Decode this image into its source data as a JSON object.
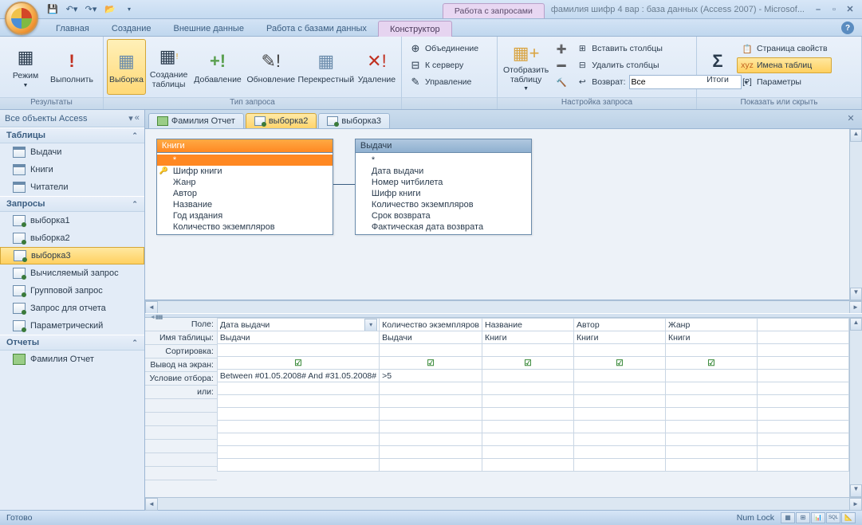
{
  "title": {
    "context": "Работа с запросами",
    "app": "фамилия шифр 4 вар : база данных (Access 2007) - Microsof..."
  },
  "menu": {
    "tabs": [
      "Главная",
      "Создание",
      "Внешние данные",
      "Работа с базами данных",
      "Конструктор"
    ],
    "active": 4
  },
  "ribbon": {
    "g0": {
      "label": "Результаты",
      "mode": "Режим",
      "run": "Выполнить"
    },
    "g1": {
      "label": "Тип запроса",
      "select": "Выборка",
      "maketable": "Создание таблицы",
      "append": "Добавление",
      "update": "Обновление",
      "cross": "Перекрестный",
      "delete": "Удаление"
    },
    "g2": {
      "union": "Объединение",
      "passthrough": "К серверу",
      "datadef": "Управление"
    },
    "g3": {
      "label": "Настройка запроса",
      "showtable": "Отобразить таблицу",
      "inscols": "Вставить столбцы",
      "delcols": "Удалить столбцы",
      "return": "Возврат:",
      "return_val": "Все"
    },
    "g4": {
      "label": "Показать или скрыть",
      "totals": "Итоги",
      "props": "Страница свойств",
      "names": "Имена таблиц",
      "params": "Параметры"
    }
  },
  "nav": {
    "header": "Все объекты Access",
    "groups": [
      {
        "title": "Таблицы",
        "type": "tbl",
        "items": [
          "Выдачи",
          "Книги",
          "Читатели"
        ]
      },
      {
        "title": "Запросы",
        "type": "qry",
        "items": [
          "выборка1",
          "выборка2",
          "выборка3",
          "Вычисляемый запрос",
          "Групповой запрос",
          "Запрос для отчета",
          "Параметрический"
        ],
        "selected": 2
      },
      {
        "title": "Отчеты",
        "type": "rpt",
        "items": [
          "Фамилия Отчет"
        ]
      }
    ]
  },
  "doctabs": {
    "items": [
      "Фамилия Отчет",
      "выборка2",
      "выборка3"
    ],
    "active": 1
  },
  "tables_pane": {
    "t1": {
      "title": "Книги",
      "fields": [
        "*",
        "Шифр книги",
        "Жанр",
        "Автор",
        "Название",
        "Год издания",
        "Количество экземпляров"
      ],
      "key": 1,
      "selected": true
    },
    "t2": {
      "title": "Выдачи",
      "fields": [
        "*",
        "Дата выдачи",
        "Номер читбилета",
        "Шифр книги",
        "Количество экземпляров",
        "Срок возврата",
        "Фактическая дата возврата"
      ]
    }
  },
  "grid": {
    "rows": [
      "Поле:",
      "Имя таблицы:",
      "Сортировка:",
      "Вывод на экран:",
      "Условие отбора:",
      "или:"
    ],
    "cols": [
      {
        "field": "Дата выдачи",
        "table": "Выдачи",
        "show": true,
        "crit": "Between #01.05.2008# And #31.05.2008#"
      },
      {
        "field": "Количество экземпляров",
        "table": "Выдачи",
        "show": true,
        "crit": ">5"
      },
      {
        "field": "Название",
        "table": "Книги",
        "show": true,
        "crit": ""
      },
      {
        "field": "Автор",
        "table": "Книги",
        "show": true,
        "crit": ""
      },
      {
        "field": "Жанр",
        "table": "Книги",
        "show": true,
        "crit": ""
      },
      {
        "field": "",
        "table": "",
        "show": false,
        "crit": ""
      }
    ]
  },
  "status": {
    "left": "Готово",
    "numlock": "Num Lock"
  }
}
